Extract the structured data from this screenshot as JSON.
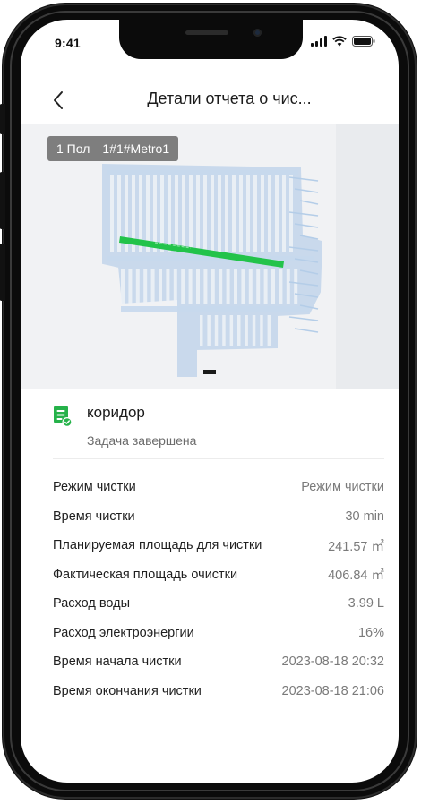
{
  "status_bar": {
    "time": "9:41"
  },
  "header": {
    "title": "Детали отчета о чис..."
  },
  "map": {
    "floor": "1 Пол",
    "map_name": "1#1#Metro1",
    "colors": {
      "floor_plan": "#a9c6e6",
      "cleaning_path": "#22c34a",
      "background": "#f1f2f4"
    }
  },
  "task": {
    "name": "коридор",
    "status": "Задача завершена",
    "icon": "task-complete-icon",
    "accent_color": "#26b24a"
  },
  "details": [
    {
      "label": "Режим чистки",
      "value": "Режим чистки"
    },
    {
      "label": "Время чистки",
      "value": "30 min"
    },
    {
      "label": "Планируемая площадь для чистки",
      "value": "241.57 ㎡"
    },
    {
      "label": "Фактическая площадь очистки",
      "value": "406.84 ㎡"
    },
    {
      "label": "Расход воды",
      "value": "3.99 L"
    },
    {
      "label": "Расход электроэнергии",
      "value": "16%"
    },
    {
      "label": "Время начала чистки",
      "value": "2023-08-18 20:32"
    },
    {
      "label": "Время окончания чистки",
      "value": "2023-08-18 21:06"
    }
  ]
}
